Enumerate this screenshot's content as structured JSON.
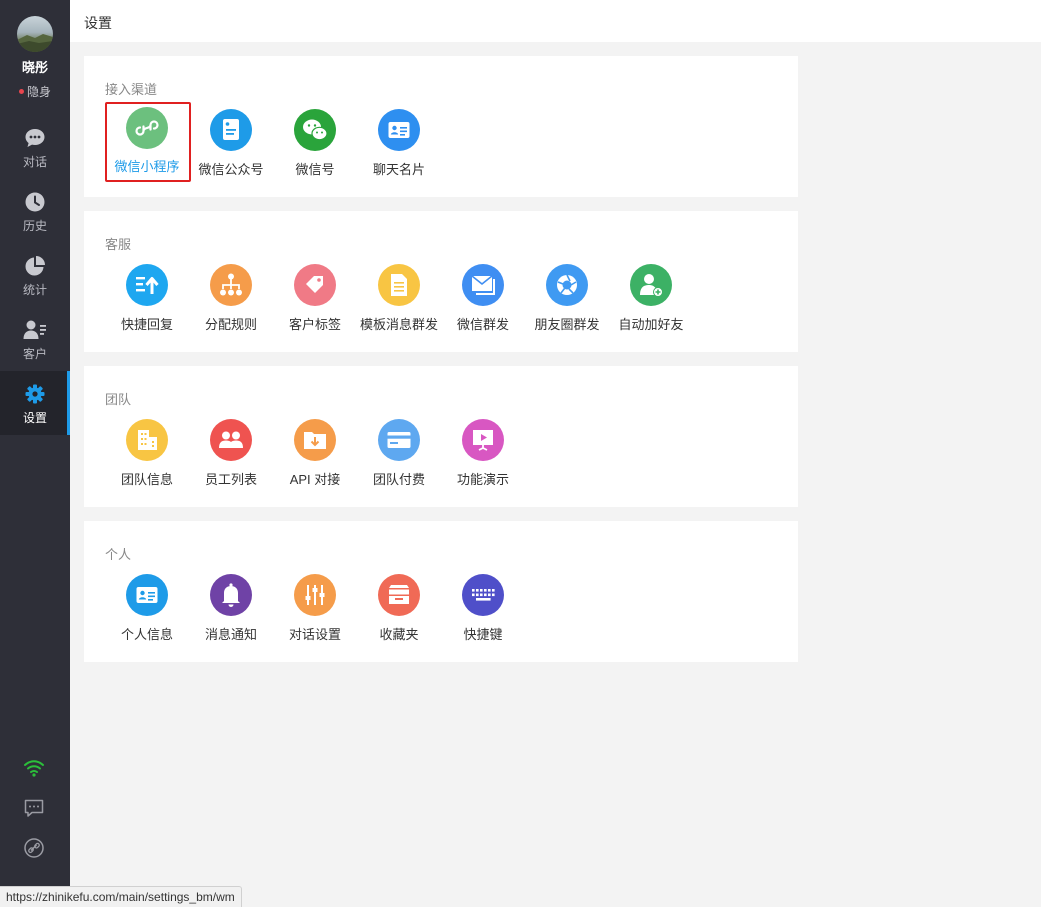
{
  "sidebar": {
    "username": "晓彤",
    "status": "隐身",
    "items": [
      {
        "label": "对话",
        "icon": "chat-bubble-icon"
      },
      {
        "label": "历史",
        "icon": "clock-icon"
      },
      {
        "label": "统计",
        "icon": "pie-chart-icon"
      },
      {
        "label": "客户",
        "icon": "customer-list-icon"
      },
      {
        "label": "设置",
        "icon": "gear-icon",
        "active": true
      }
    ],
    "bottom_icons": [
      "wifi-icon",
      "message-icon",
      "link-icon"
    ]
  },
  "header": {
    "title": "设置"
  },
  "sections": [
    {
      "title": "接入渠道",
      "items": [
        {
          "label": "微信小程序",
          "icon": "mini-program-icon",
          "color": "#6cc07e",
          "selected": true
        },
        {
          "label": "微信公众号",
          "icon": "official-account-icon",
          "color": "#1e9be8"
        },
        {
          "label": "微信号",
          "icon": "wechat-icon",
          "color": "#2aa43b"
        },
        {
          "label": "聊天名片",
          "icon": "contact-card-icon",
          "color": "#2e8ff0"
        }
      ]
    },
    {
      "title": "客服",
      "items": [
        {
          "label": "快捷回复",
          "icon": "quick-reply-icon",
          "color": "#1ea7f0"
        },
        {
          "label": "分配规则",
          "icon": "org-tree-icon",
          "color": "#f59c4a"
        },
        {
          "label": "客户标签",
          "icon": "tag-icon",
          "color": "#f07a86"
        },
        {
          "label": "模板消息群发",
          "icon": "document-icon",
          "color": "#f8c543"
        },
        {
          "label": "微信群发",
          "icon": "envelope-icon",
          "color": "#3f8ef2"
        },
        {
          "label": "朋友圈群发",
          "icon": "aperture-icon",
          "color": "#3f9af2"
        },
        {
          "label": "自动加好友",
          "icon": "add-friend-icon",
          "color": "#3cb165"
        }
      ]
    },
    {
      "title": "团队",
      "items": [
        {
          "label": "团队信息",
          "icon": "building-icon",
          "color": "#f8c543"
        },
        {
          "label": "员工列表",
          "icon": "team-icon",
          "color": "#ef5350"
        },
        {
          "label": "API 对接",
          "icon": "download-folder-icon",
          "color": "#f59c4a"
        },
        {
          "label": "团队付费",
          "icon": "credit-card-icon",
          "color": "#5ea8f0"
        },
        {
          "label": "功能演示",
          "icon": "presentation-icon",
          "color": "#d857c2"
        }
      ]
    },
    {
      "title": "个人",
      "items": [
        {
          "label": "个人信息",
          "icon": "id-card-icon",
          "color": "#1e9be8"
        },
        {
          "label": "消息通知",
          "icon": "bell-icon",
          "color": "#6f42a6"
        },
        {
          "label": "对话设置",
          "icon": "sliders-icon",
          "color": "#f59c4a"
        },
        {
          "label": "收藏夹",
          "icon": "archive-box-icon",
          "color": "#f06a56"
        },
        {
          "label": "快捷键",
          "icon": "keyboard-icon",
          "color": "#4f4fc9"
        }
      ]
    }
  ],
  "statusbar": {
    "url": "https://zhinikefu.com/main/settings_bm/wm"
  }
}
